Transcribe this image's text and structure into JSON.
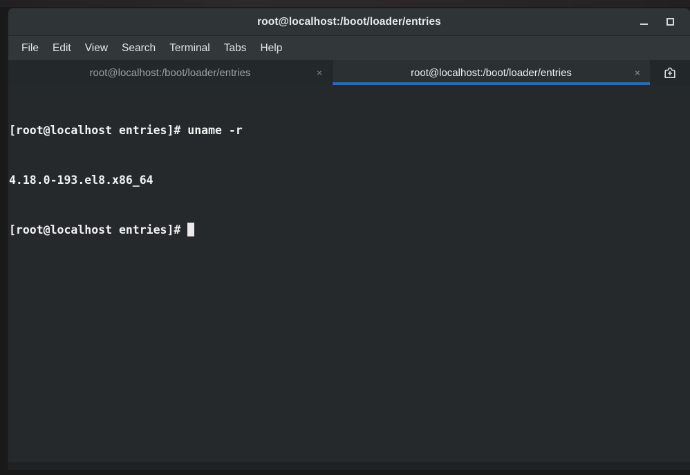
{
  "window": {
    "title": "root@localhost:/boot/loader/entries",
    "controls": [
      {
        "name": "minimize-button",
        "icon": "minimize-icon",
        "label": "_"
      },
      {
        "name": "maximize-button",
        "icon": "maximize-icon",
        "label": "□"
      }
    ]
  },
  "menubar": {
    "items": [
      {
        "label": "File"
      },
      {
        "label": "Edit"
      },
      {
        "label": "View"
      },
      {
        "label": "Search"
      },
      {
        "label": "Terminal"
      },
      {
        "label": "Tabs"
      },
      {
        "label": "Help"
      }
    ]
  },
  "tabbar": {
    "tabs": [
      {
        "label": "root@localhost:/boot/loader/entries",
        "close": "×",
        "active": false
      },
      {
        "label": "root@localhost:/boot/loader/entries",
        "close": "×",
        "active": true
      }
    ],
    "new_tab_icon": "new-tab-icon"
  },
  "terminal": {
    "lines": [
      "[root@localhost entries]# uname -r",
      "4.18.0-193.el8.x86_64",
      "[root@localhost entries]# "
    ],
    "prompt": "[root@localhost entries]# ",
    "command": "uname -r",
    "output": "4.18.0-193.el8.x86_64",
    "cursor_visible": true
  },
  "colors": {
    "accent_blue": "#2a6ab6",
    "terminal_background": "#26292b",
    "terminal_foreground": "#f2f2f2",
    "titlebar_background": "#2f3437",
    "menubar_background": "#32373a",
    "tabbar_background": "#22272a",
    "active_tab_background": "#2b3033"
  }
}
